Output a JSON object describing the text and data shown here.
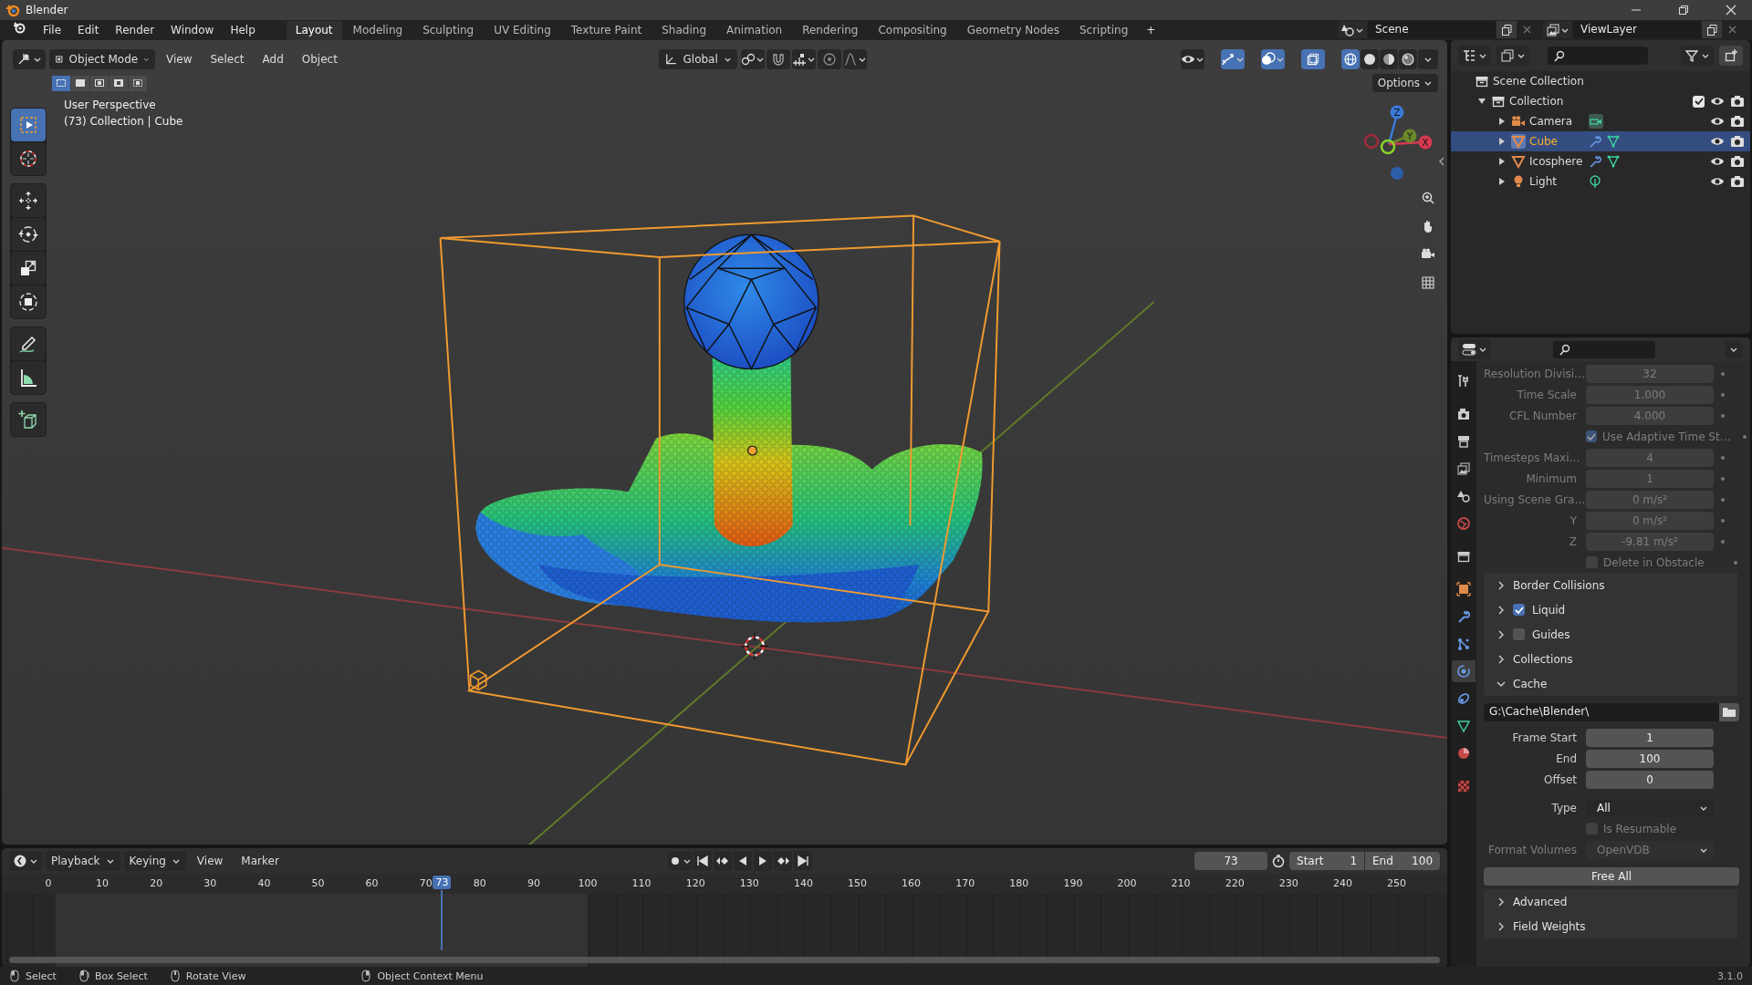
{
  "window": {
    "title": "Blender"
  },
  "menu": [
    "File",
    "Edit",
    "Render",
    "Window",
    "Help"
  ],
  "workspaces": [
    {
      "label": "Layout",
      "selected": true
    },
    {
      "label": "Modeling",
      "selected": false
    },
    {
      "label": "Sculpting",
      "selected": false
    },
    {
      "label": "UV Editing",
      "selected": false
    },
    {
      "label": "Texture Paint",
      "selected": false
    },
    {
      "label": "Shading",
      "selected": false
    },
    {
      "label": "Animation",
      "selected": false
    },
    {
      "label": "Rendering",
      "selected": false
    },
    {
      "label": "Compositing",
      "selected": false
    },
    {
      "label": "Geometry Nodes",
      "selected": false
    },
    {
      "label": "Scripting",
      "selected": false
    }
  ],
  "add_workspace": "+",
  "scene": "Scene",
  "view_layer": "ViewLayer",
  "viewport": {
    "mode": "Object Mode",
    "menus": [
      "View",
      "Select",
      "Add",
      "Object"
    ],
    "orientation": "Global",
    "options": "Options",
    "toggles": [
      {
        "kind": "gizmos",
        "on": true
      },
      {
        "kind": "overlays",
        "on": true
      },
      {
        "kind": "xray",
        "on": true
      }
    ],
    "shading": [
      {
        "kind": "wireframe",
        "selected": true
      },
      {
        "kind": "solid",
        "selected": false
      },
      {
        "kind": "material",
        "selected": false
      },
      {
        "kind": "rendered",
        "selected": false
      }
    ],
    "select_modes": [
      {
        "selected": true
      },
      {
        "selected": false
      },
      {
        "selected": false
      },
      {
        "selected": false
      },
      {
        "selected": false
      }
    ],
    "info": [
      "User Perspective",
      "(73) Collection | Cube"
    ],
    "tools": [
      {
        "kind": "select",
        "selected": true
      },
      {
        "kind": "cursor",
        "selected": false
      },
      {
        "kind": "move",
        "selected": false
      },
      {
        "kind": "rotate",
        "selected": false
      },
      {
        "kind": "scale",
        "selected": false
      },
      {
        "kind": "transform",
        "selected": false
      },
      {
        "kind": "annotate",
        "selected": false
      },
      {
        "kind": "measure",
        "selected": false
      },
      {
        "kind": "add_cube",
        "selected": false
      }
    ],
    "gizmo": [
      "Z",
      "Y",
      "X"
    ]
  },
  "outliner": {
    "root": "Scene Collection",
    "tree": [
      {
        "label": "Collection",
        "kind": "collection",
        "expanded": true,
        "checked": true,
        "selected": false,
        "children": [
          {
            "label": "Camera",
            "kind": "camera",
            "expanded": false,
            "selected": false
          },
          {
            "label": "Cube",
            "kind": "mesh",
            "expanded": false,
            "selected": true
          },
          {
            "label": "Icosphere",
            "kind": "mesh",
            "expanded": false,
            "selected": false
          },
          {
            "label": "Light",
            "kind": "light",
            "expanded": false,
            "selected": false
          }
        ]
      }
    ]
  },
  "properties": {
    "tabs": [
      {
        "kind": "tool",
        "selected": false
      },
      {
        "kind": "render",
        "selected": false
      },
      {
        "kind": "output",
        "selected": false
      },
      {
        "kind": "view_layer",
        "selected": false
      },
      {
        "kind": "scene",
        "selected": false
      },
      {
        "kind": "world",
        "selected": false
      },
      {
        "kind": "collection",
        "selected": false
      },
      {
        "kind": "object",
        "selected": false
      },
      {
        "kind": "modifiers",
        "selected": false
      },
      {
        "kind": "particles",
        "selected": false
      },
      {
        "kind": "physics",
        "selected": true
      },
      {
        "kind": "constraints",
        "selected": false
      },
      {
        "kind": "data",
        "selected": false
      },
      {
        "kind": "material",
        "selected": false
      },
      {
        "kind": "texture",
        "selected": false
      }
    ],
    "items": [
      {
        "kind": "number",
        "label": "Resolution Divisi…",
        "value": "32",
        "disabled": true,
        "decorator": true
      },
      {
        "kind": "number",
        "label": "Time Scale",
        "value": "1.000",
        "disabled": true,
        "decorator": true
      },
      {
        "kind": "number",
        "label": "CFL Number",
        "value": "4.000",
        "disabled": true,
        "decorator": true
      },
      {
        "kind": "checkbox",
        "label": "Use Adaptive Time St…",
        "checked": true,
        "disabled": true,
        "decorator": true
      },
      {
        "kind": "number",
        "label": "Timesteps Maxi…",
        "value": "4",
        "disabled": true,
        "decorator": true
      },
      {
        "kind": "number",
        "label": "Minimum",
        "value": "1",
        "disabled": true,
        "decorator": true
      },
      {
        "kind": "number",
        "label": "Using Scene Gra…",
        "value": "0 m/s²",
        "disabled": true,
        "decorator": true
      },
      {
        "kind": "number",
        "label": "Y",
        "value": "0 m/s²",
        "disabled": true,
        "decorator": true
      },
      {
        "kind": "number",
        "label": "Z",
        "value": "-9.81 m/s²",
        "disabled": true,
        "decorator": true
      },
      {
        "kind": "checkbox",
        "label": "Delete in Obstacle",
        "checked": false,
        "disabled": true,
        "decorator": true
      },
      {
        "kind": "panel",
        "label": "Border Collisions",
        "expanded": false
      },
      {
        "kind": "panel",
        "label": "Liquid",
        "expanded": false,
        "checked": true
      },
      {
        "kind": "panel",
        "label": "Guides",
        "expanded": false,
        "checked": false
      },
      {
        "kind": "panel",
        "label": "Collections",
        "expanded": false
      },
      {
        "kind": "panel",
        "label": "Cache",
        "expanded": true
      },
      {
        "kind": "path",
        "value": "G:\\Cache\\Blender\\"
      },
      {
        "kind": "number",
        "label": "Frame Start",
        "value": "1",
        "disabled": false
      },
      {
        "kind": "number",
        "label": "End",
        "value": "100",
        "disabled": false
      },
      {
        "kind": "number",
        "label": "Offset",
        "value": "0",
        "disabled": false
      },
      {
        "kind": "dropdown",
        "label": "Type",
        "value": "All",
        "disabled": false
      },
      {
        "kind": "checkbox",
        "label": "Is Resumable",
        "checked": false,
        "disabled": true
      },
      {
        "kind": "dropdown",
        "label": "Format Volumes",
        "value": "OpenVDB",
        "disabled": true
      },
      {
        "kind": "button",
        "label": "Free All"
      },
      {
        "kind": "panel",
        "label": "Advanced",
        "expanded": false
      },
      {
        "kind": "panel",
        "label": "Field Weights",
        "expanded": false
      }
    ]
  },
  "timeline": {
    "menus": [
      "Playback",
      "Keying",
      "View",
      "Marker"
    ],
    "current_frame": "73",
    "start_label": "Start",
    "start": "1",
    "end_label": "End",
    "end": "100",
    "ticks": [
      "0",
      "10",
      "20",
      "30",
      "40",
      "50",
      "60",
      "70",
      "80",
      "90",
      "100",
      "110",
      "120",
      "130",
      "140",
      "150",
      "160",
      "170",
      "180",
      "190",
      "200",
      "210",
      "220",
      "230",
      "240",
      "250"
    ],
    "playhead": "73"
  },
  "status": {
    "hints": [
      "Select",
      "Box Select",
      "Rotate View",
      "Object Context Menu"
    ],
    "version": "3.1.0"
  }
}
